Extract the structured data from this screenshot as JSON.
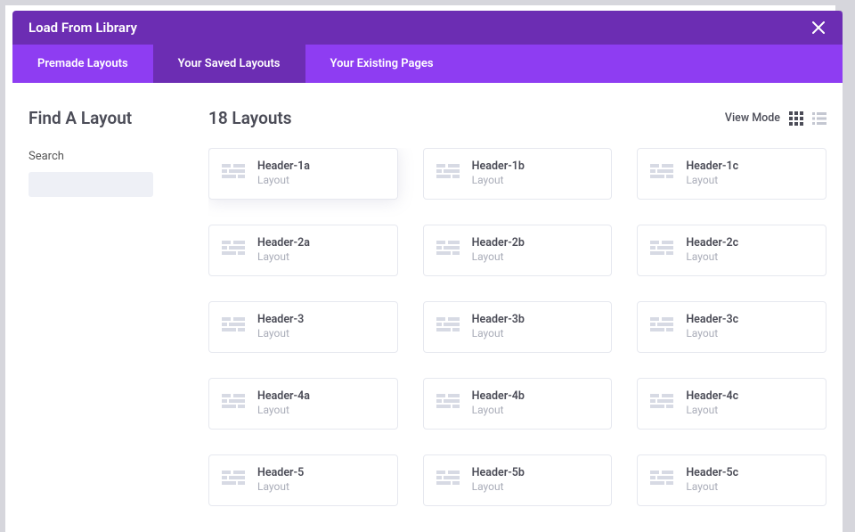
{
  "header": {
    "title": "Load From Library"
  },
  "tabs": [
    {
      "label": "Premade Layouts",
      "active": false
    },
    {
      "label": "Your Saved Layouts",
      "active": true
    },
    {
      "label": "Your Existing Pages",
      "active": false
    }
  ],
  "sidebar": {
    "title": "Find A Layout",
    "searchLabel": "Search"
  },
  "main": {
    "count": "18 Layouts",
    "viewModeLabel": "View Mode"
  },
  "cards": [
    {
      "title": "Header-1a",
      "sub": "Layout",
      "highlight": true
    },
    {
      "title": "Header-1b",
      "sub": "Layout"
    },
    {
      "title": "Header-1c",
      "sub": "Layout"
    },
    {
      "title": "Header-2a",
      "sub": "Layout"
    },
    {
      "title": "Header-2b",
      "sub": "Layout"
    },
    {
      "title": "Header-2c",
      "sub": "Layout"
    },
    {
      "title": "Header-3",
      "sub": "Layout"
    },
    {
      "title": "Header-3b",
      "sub": "Layout"
    },
    {
      "title": "Header-3c",
      "sub": "Layout"
    },
    {
      "title": "Header-4a",
      "sub": "Layout"
    },
    {
      "title": "Header-4b",
      "sub": "Layout"
    },
    {
      "title": "Header-4c",
      "sub": "Layout"
    },
    {
      "title": "Header-5",
      "sub": "Layout"
    },
    {
      "title": "Header-5b",
      "sub": "Layout"
    },
    {
      "title": "Header-5c",
      "sub": "Layout"
    }
  ]
}
